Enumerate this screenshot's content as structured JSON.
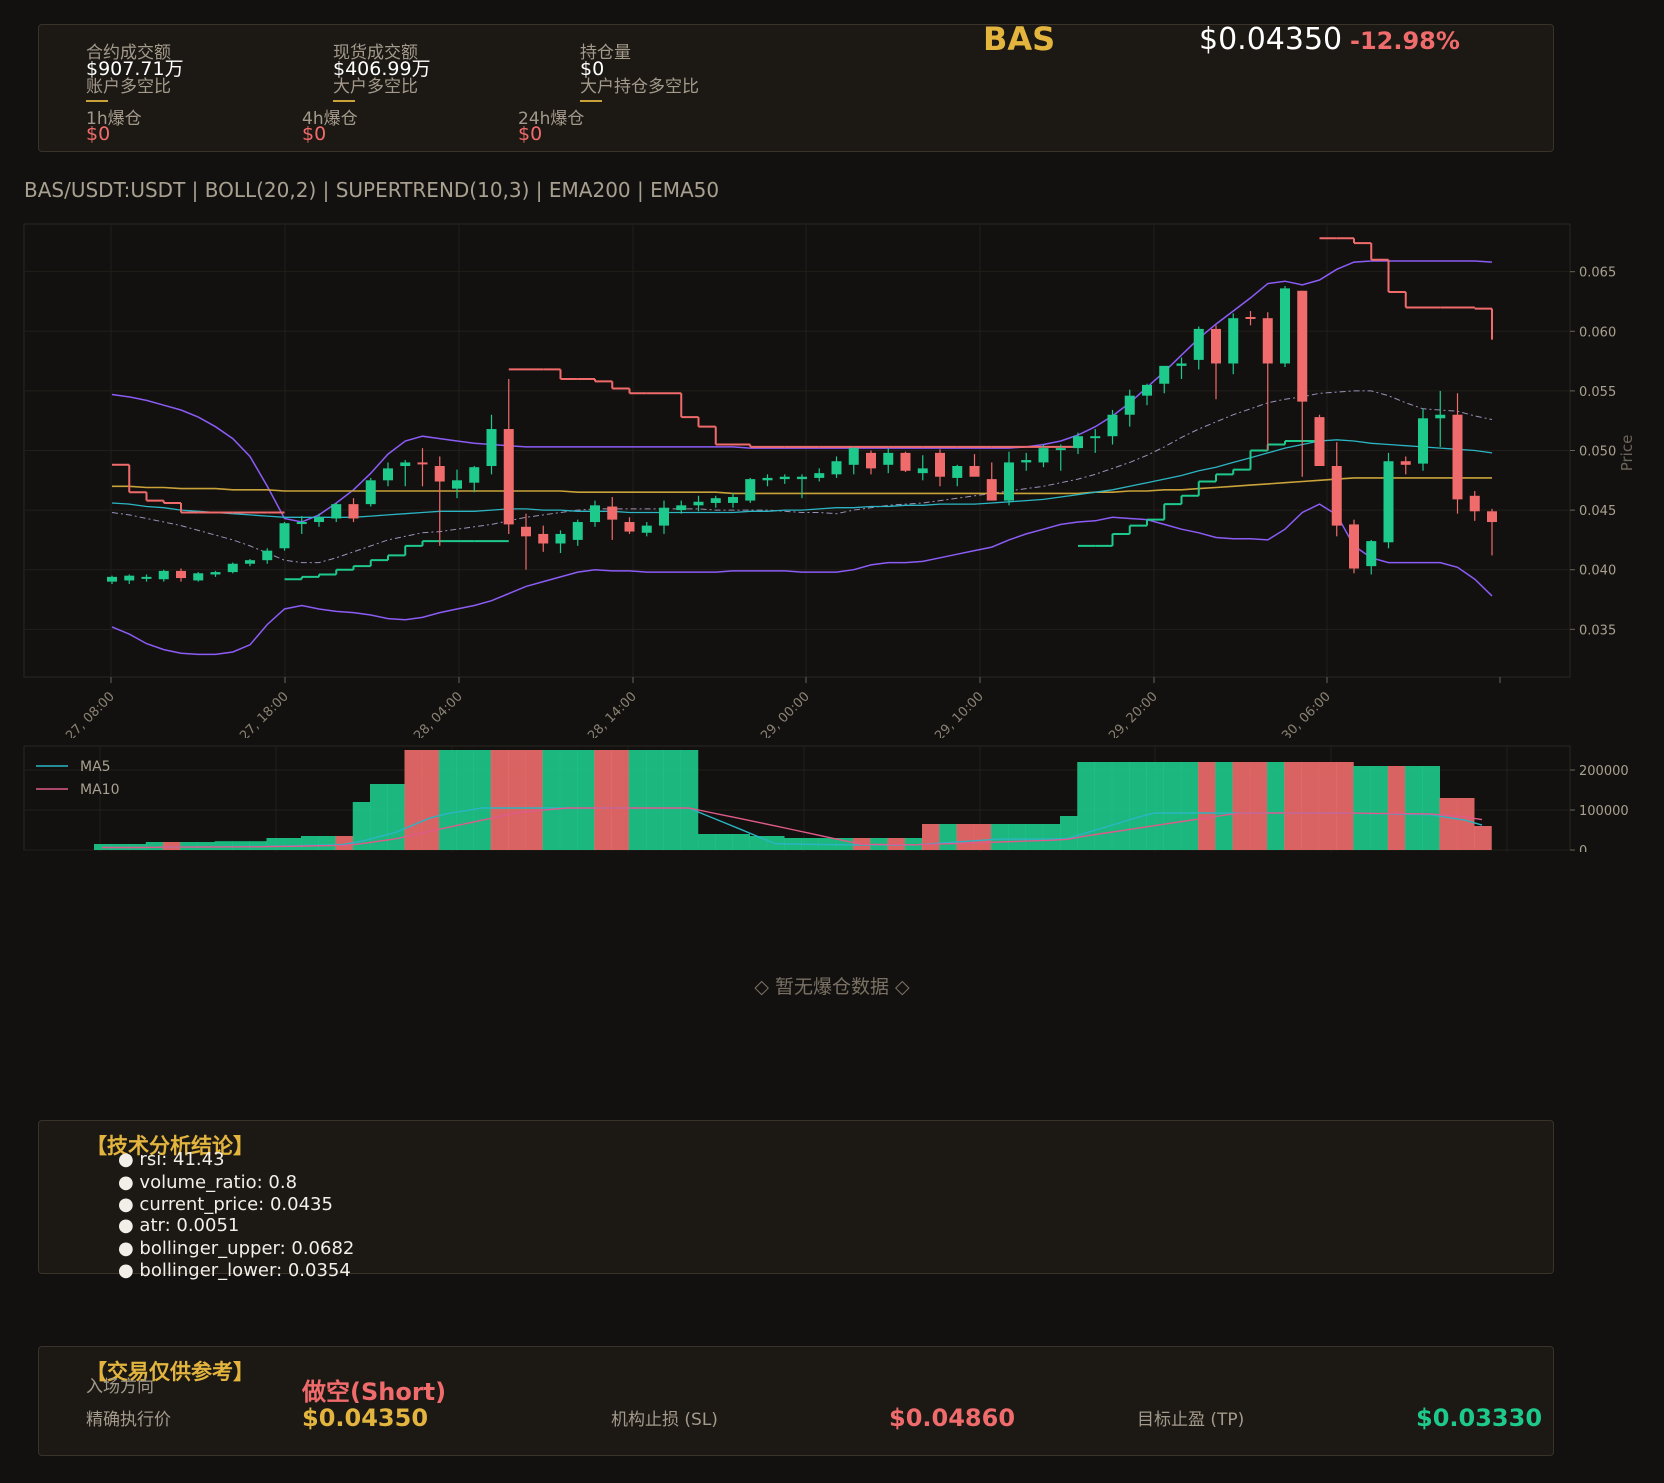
{
  "header": {
    "symbol": "BAS",
    "price": "$0.04350",
    "change": "-12.98%",
    "futures_volume_label": "合约成交额",
    "futures_volume": "$907.71万",
    "spot_volume_label": "现货成交额",
    "spot_volume": "$406.99万",
    "open_interest_label": "持仓量",
    "open_interest": "$0",
    "account_ls_label": "账户多空比",
    "top_trader_ls_label": "大户多空比",
    "top_position_ls_label": "大户持仓多空比",
    "liq_1h_label": "1h爆仓",
    "liq_1h": "$0",
    "liq_4h_label": "4h爆仓",
    "liq_4h": "$0",
    "liq_24h_label": "24h爆仓",
    "liq_24h": "$0"
  },
  "colors": {
    "up": "#1ec98c",
    "down": "#f06b6b",
    "boll": "#8b5cf6",
    "ema200": "#c9a33a",
    "ema50": "#2bb5c4",
    "gold": "#e3b53e",
    "ma5": "#2bb5c4",
    "ma10": "#e05a8a"
  },
  "chart_data": [
    {
      "type": "candlestick",
      "title": "BAS/USDT:USDT | BOLL(20,2) | SUPERTREND(10,3) | EMA200 | EMA50",
      "ylabel": "Price",
      "ylim": [
        0.031,
        0.069
      ],
      "y_ticks": [
        "0.035",
        "0.040",
        "0.045",
        "0.050",
        "0.055",
        "0.060",
        "0.065"
      ],
      "x_tick_labels": [
        "Jun 27, 08:00",
        "Jun 27, 18:00",
        "Jun 28, 04:00",
        "Jun 28, 14:00",
        "Jun 29, 00:00",
        "Jun 29, 10:00",
        "Jun 29, 20:00",
        "Jun 30, 06:00"
      ],
      "candles": [
        [
          0.039,
          0.0395,
          0.0388,
          0.0394
        ],
        [
          0.0391,
          0.0396,
          0.0388,
          0.0395
        ],
        [
          0.0393,
          0.0396,
          0.039,
          0.0394
        ],
        [
          0.0392,
          0.04,
          0.039,
          0.0399
        ],
        [
          0.0399,
          0.0401,
          0.039,
          0.0393
        ],
        [
          0.0391,
          0.0398,
          0.039,
          0.0397
        ],
        [
          0.0396,
          0.0399,
          0.0394,
          0.0398
        ],
        [
          0.0398,
          0.0406,
          0.0397,
          0.0405
        ],
        [
          0.0405,
          0.0409,
          0.0403,
          0.0408
        ],
        [
          0.0408,
          0.0418,
          0.0405,
          0.0416
        ],
        [
          0.0418,
          0.044,
          0.0416,
          0.0439
        ],
        [
          0.0439,
          0.0445,
          0.043,
          0.044
        ],
        [
          0.044,
          0.0447,
          0.0436,
          0.0444
        ],
        [
          0.0443,
          0.0456,
          0.044,
          0.0455
        ],
        [
          0.0455,
          0.046,
          0.044,
          0.0443
        ],
        [
          0.0455,
          0.0477,
          0.0453,
          0.0475
        ],
        [
          0.0475,
          0.049,
          0.047,
          0.0485
        ],
        [
          0.0487,
          0.0492,
          0.047,
          0.049
        ],
        [
          0.049,
          0.0502,
          0.047,
          0.0489
        ],
        [
          0.0487,
          0.0495,
          0.042,
          0.0474
        ],
        [
          0.0468,
          0.0484,
          0.046,
          0.0475
        ],
        [
          0.0473,
          0.0487,
          0.0465,
          0.0486
        ],
        [
          0.0487,
          0.053,
          0.048,
          0.0518
        ],
        [
          0.0518,
          0.056,
          0.043,
          0.0438
        ],
        [
          0.0436,
          0.0447,
          0.04,
          0.0428
        ],
        [
          0.043,
          0.0437,
          0.0415,
          0.0422
        ],
        [
          0.0422,
          0.0433,
          0.0414,
          0.043
        ],
        [
          0.0425,
          0.0442,
          0.042,
          0.044
        ],
        [
          0.044,
          0.0458,
          0.0436,
          0.0454
        ],
        [
          0.0453,
          0.0461,
          0.0425,
          0.0442
        ],
        [
          0.044,
          0.0444,
          0.043,
          0.0432
        ],
        [
          0.0431,
          0.044,
          0.0428,
          0.0437
        ],
        [
          0.0437,
          0.0458,
          0.043,
          0.0452
        ],
        [
          0.045,
          0.0458,
          0.0447,
          0.0454
        ],
        [
          0.0454,
          0.0462,
          0.0449,
          0.0457
        ],
        [
          0.0456,
          0.0462,
          0.0452,
          0.046
        ],
        [
          0.0456,
          0.0464,
          0.0452,
          0.0461
        ],
        [
          0.0458,
          0.0477,
          0.0456,
          0.0476
        ],
        [
          0.0475,
          0.048,
          0.047,
          0.0477
        ],
        [
          0.0476,
          0.048,
          0.0472,
          0.0478
        ],
        [
          0.0476,
          0.048,
          0.046,
          0.0478
        ],
        [
          0.0477,
          0.0485,
          0.0474,
          0.0481
        ],
        [
          0.048,
          0.0495,
          0.0477,
          0.0491
        ],
        [
          0.0488,
          0.0503,
          0.048,
          0.0502
        ],
        [
          0.0498,
          0.05,
          0.048,
          0.0485
        ],
        [
          0.0488,
          0.0502,
          0.0481,
          0.0498
        ],
        [
          0.0498,
          0.0499,
          0.0482,
          0.0483
        ],
        [
          0.0481,
          0.0496,
          0.0475,
          0.0485
        ],
        [
          0.0498,
          0.0501,
          0.047,
          0.0478
        ],
        [
          0.0477,
          0.0488,
          0.047,
          0.0487
        ],
        [
          0.0487,
          0.0497,
          0.0482,
          0.0478
        ],
        [
          0.0476,
          0.049,
          0.0468,
          0.0458
        ],
        [
          0.0458,
          0.0499,
          0.0454,
          0.049
        ],
        [
          0.049,
          0.0498,
          0.0483,
          0.0492
        ],
        [
          0.049,
          0.0505,
          0.0486,
          0.0502
        ],
        [
          0.0502,
          0.0505,
          0.0483,
          0.0502
        ],
        [
          0.0502,
          0.0515,
          0.0497,
          0.0512
        ],
        [
          0.0512,
          0.0518,
          0.0498,
          0.0512
        ],
        [
          0.0512,
          0.0534,
          0.0505,
          0.053
        ],
        [
          0.053,
          0.0551,
          0.052,
          0.0546
        ],
        [
          0.0546,
          0.0556,
          0.0538,
          0.0555
        ],
        [
          0.0556,
          0.057,
          0.0548,
          0.0571
        ],
        [
          0.0571,
          0.0578,
          0.056,
          0.0573
        ],
        [
          0.0576,
          0.0604,
          0.0568,
          0.0602
        ],
        [
          0.0602,
          0.0605,
          0.0543,
          0.0573
        ],
        [
          0.0573,
          0.0615,
          0.0564,
          0.0611
        ],
        [
          0.0612,
          0.0617,
          0.0605,
          0.0611
        ],
        [
          0.0611,
          0.0616,
          0.05,
          0.0573
        ],
        [
          0.0573,
          0.0638,
          0.057,
          0.0636
        ],
        [
          0.0634,
          0.0634,
          0.0478,
          0.0541
        ],
        [
          0.0528,
          0.053,
          0.049,
          0.0487
        ],
        [
          0.0487,
          0.0507,
          0.0428,
          0.0437
        ],
        [
          0.0438,
          0.0442,
          0.0397,
          0.0401
        ],
        [
          0.0403,
          0.0425,
          0.0396,
          0.0424
        ],
        [
          0.0423,
          0.0498,
          0.0418,
          0.0491
        ],
        [
          0.0491,
          0.0495,
          0.048,
          0.0488
        ],
        [
          0.0489,
          0.0535,
          0.0483,
          0.0527
        ],
        [
          0.0527,
          0.055,
          0.0503,
          0.053
        ],
        [
          0.053,
          0.0548,
          0.0447,
          0.0459
        ],
        [
          0.0462,
          0.0466,
          0.0441,
          0.0449
        ],
        [
          0.0449,
          0.0451,
          0.0412,
          0.044
        ]
      ],
      "boll_upper": [
        0.0547,
        0.0545,
        0.0542,
        0.0538,
        0.0534,
        0.0528,
        0.052,
        0.051,
        0.0495,
        0.047,
        0.0443,
        0.044,
        0.0446,
        0.0456,
        0.0467,
        0.0481,
        0.0497,
        0.0508,
        0.0512,
        0.051,
        0.0508,
        0.0506,
        0.0505,
        0.0504,
        0.0503,
        0.0503,
        0.0503,
        0.0503,
        0.0503,
        0.0503,
        0.0503,
        0.0503,
        0.0503,
        0.0503,
        0.0503,
        0.0503,
        0.0503,
        0.0502,
        0.0502,
        0.0502,
        0.0502,
        0.0502,
        0.0502,
        0.0502,
        0.0502,
        0.0502,
        0.0502,
        0.0502,
        0.0502,
        0.0502,
        0.0502,
        0.0502,
        0.0502,
        0.0503,
        0.0505,
        0.0508,
        0.0513,
        0.052,
        0.0529,
        0.054,
        0.0553,
        0.0566,
        0.058,
        0.0594,
        0.0606,
        0.0617,
        0.0628,
        0.064,
        0.0642,
        0.0639,
        0.0643,
        0.0652,
        0.0658,
        0.0659,
        0.0659,
        0.0659,
        0.0659,
        0.0659,
        0.0659,
        0.0659,
        0.0658
      ],
      "boll_lower": [
        0.0352,
        0.0346,
        0.0338,
        0.0333,
        0.033,
        0.0329,
        0.0329,
        0.0331,
        0.0337,
        0.0354,
        0.0367,
        0.037,
        0.0367,
        0.0365,
        0.0364,
        0.0362,
        0.0359,
        0.0358,
        0.036,
        0.0364,
        0.0367,
        0.037,
        0.0374,
        0.038,
        0.0386,
        0.039,
        0.0394,
        0.0398,
        0.04,
        0.0399,
        0.0399,
        0.0398,
        0.0398,
        0.0398,
        0.0398,
        0.0398,
        0.0399,
        0.0399,
        0.0399,
        0.0399,
        0.0398,
        0.0398,
        0.0398,
        0.04,
        0.0404,
        0.0406,
        0.0406,
        0.0407,
        0.041,
        0.0413,
        0.0416,
        0.0419,
        0.0425,
        0.043,
        0.0434,
        0.0438,
        0.044,
        0.0441,
        0.0444,
        0.0443,
        0.0442,
        0.0438,
        0.0434,
        0.0431,
        0.0427,
        0.0426,
        0.0426,
        0.0425,
        0.0434,
        0.0448,
        0.0455,
        0.0446,
        0.042,
        0.041,
        0.0406,
        0.0406,
        0.0406,
        0.0406,
        0.0402,
        0.0392,
        0.0378
      ],
      "boll_mid": [
        0.0448,
        0.0446,
        0.0443,
        0.044,
        0.0437,
        0.0433,
        0.0429,
        0.0425,
        0.042,
        0.0414,
        0.0408,
        0.0406,
        0.0406,
        0.041,
        0.0415,
        0.042,
        0.0425,
        0.0428,
        0.0431,
        0.0432,
        0.0434,
        0.0436,
        0.0438,
        0.0441,
        0.0444,
        0.0446,
        0.0448,
        0.045,
        0.0451,
        0.0451,
        0.0451,
        0.0451,
        0.0451,
        0.0451,
        0.0451,
        0.045,
        0.045,
        0.045,
        0.045,
        0.0449,
        0.0448,
        0.0448,
        0.0447,
        0.045,
        0.0452,
        0.0454,
        0.0455,
        0.0456,
        0.0458,
        0.046,
        0.0462,
        0.0464,
        0.0466,
        0.0468,
        0.047,
        0.0473,
        0.0476,
        0.048,
        0.0485,
        0.049,
        0.0496,
        0.0503,
        0.0511,
        0.0518,
        0.0524,
        0.053,
        0.0535,
        0.054,
        0.0543,
        0.0545,
        0.0548,
        0.0549,
        0.055,
        0.055,
        0.0546,
        0.054,
        0.0535,
        0.0534,
        0.0533,
        0.0529,
        0.0526
      ],
      "ema200": [
        0.047,
        0.047,
        0.0469,
        0.0469,
        0.0468,
        0.0468,
        0.0468,
        0.0467,
        0.0467,
        0.0467,
        0.0466,
        0.0466,
        0.0466,
        0.0466,
        0.0466,
        0.0466,
        0.0466,
        0.0466,
        0.0466,
        0.0466,
        0.0466,
        0.0466,
        0.0466,
        0.0466,
        0.0466,
        0.0466,
        0.0466,
        0.0465,
        0.0465,
        0.0465,
        0.0465,
        0.0465,
        0.0465,
        0.0465,
        0.0465,
        0.0465,
        0.0464,
        0.0464,
        0.0464,
        0.0464,
        0.0464,
        0.0464,
        0.0464,
        0.0464,
        0.0464,
        0.0464,
        0.0464,
        0.0464,
        0.0464,
        0.0464,
        0.0464,
        0.0464,
        0.0464,
        0.0464,
        0.0464,
        0.0464,
        0.0464,
        0.0465,
        0.0465,
        0.0466,
        0.0466,
        0.0467,
        0.0467,
        0.0468,
        0.0469,
        0.047,
        0.0471,
        0.0472,
        0.0473,
        0.0474,
        0.0475,
        0.0476,
        0.0477,
        0.0477,
        0.0477,
        0.0477,
        0.0477,
        0.0477,
        0.0477,
        0.0477,
        0.0477
      ],
      "ema50": [
        0.0456,
        0.0455,
        0.0453,
        0.0452,
        0.045,
        0.0449,
        0.0448,
        0.0447,
        0.0446,
        0.0445,
        0.0444,
        0.0444,
        0.0444,
        0.0444,
        0.0444,
        0.0445,
        0.0446,
        0.0447,
        0.0448,
        0.0449,
        0.0449,
        0.0449,
        0.045,
        0.0451,
        0.0451,
        0.045,
        0.045,
        0.0449,
        0.0449,
        0.0449,
        0.0448,
        0.0448,
        0.0448,
        0.0448,
        0.0448,
        0.0448,
        0.0448,
        0.0449,
        0.0449,
        0.045,
        0.045,
        0.0451,
        0.0452,
        0.0452,
        0.0453,
        0.0453,
        0.0454,
        0.0454,
        0.0455,
        0.0455,
        0.0455,
        0.0456,
        0.0457,
        0.0458,
        0.0459,
        0.0461,
        0.0463,
        0.0465,
        0.0467,
        0.047,
        0.0473,
        0.0476,
        0.0479,
        0.0483,
        0.0486,
        0.049,
        0.0494,
        0.0498,
        0.0502,
        0.0505,
        0.0508,
        0.0509,
        0.0508,
        0.0506,
        0.0505,
        0.0504,
        0.0503,
        0.0502,
        0.0501,
        0.05,
        0.0498
      ],
      "supertrend": [
        0.0488,
        0.0465,
        0.0458,
        0.0456,
        0.0448,
        0.0448,
        0.0448,
        0.0448,
        0.0448,
        0.0448,
        0.0392,
        0.0394,
        0.0396,
        0.04,
        0.0403,
        0.0408,
        0.0412,
        0.042,
        0.0424,
        0.0424,
        0.0424,
        0.0424,
        0.0424,
        0.0568,
        0.0568,
        0.0568,
        0.056,
        0.056,
        0.0558,
        0.0552,
        0.0548,
        0.0548,
        0.0548,
        0.0528,
        0.052,
        0.0505,
        0.0505,
        0.0503,
        0.0503,
        0.0503,
        0.0503,
        0.0503,
        0.0503,
        0.0503,
        0.0503,
        0.0503,
        0.0503,
        0.0503,
        0.0503,
        0.0503,
        0.0503,
        0.0503,
        0.0503,
        0.0503,
        0.0503,
        0.0503,
        0.042,
        0.042,
        0.043,
        0.0437,
        0.0442,
        0.0455,
        0.0462,
        0.0474,
        0.048,
        0.0484,
        0.05,
        0.0505,
        0.0508,
        0.0508,
        0.0678,
        0.0678,
        0.0674,
        0.066,
        0.0633,
        0.062,
        0.062,
        0.062,
        0.062,
        0.0619,
        0.0593
      ]
    },
    {
      "type": "bar",
      "series": [
        {
          "name": "MA5"
        },
        {
          "name": "MA10"
        }
      ],
      "ylim": [
        0,
        260000
      ],
      "y_ticks": [
        "0",
        "100000",
        "200000"
      ],
      "values": [
        15000,
        15000,
        15000,
        20000,
        20000,
        20000,
        20000,
        22000,
        22000,
        22000,
        30000,
        30000,
        35000,
        35000,
        35000,
        120000,
        165000,
        165000,
        250000,
        250000,
        250000,
        250000,
        250000,
        250000,
        250000,
        250000,
        250000,
        250000,
        250000,
        250000,
        250000,
        250000,
        250000,
        250000,
        250000,
        40000,
        40000,
        40000,
        35000,
        35000,
        30000,
        30000,
        30000,
        30000,
        30000,
        30000,
        30000,
        30000,
        65000,
        65000,
        65000,
        65000,
        65000,
        65000,
        65000,
        65000,
        85000,
        220000,
        220000,
        220000,
        220000,
        220000,
        220000,
        220000,
        220000,
        220000,
        220000,
        220000,
        220000,
        220000,
        220000,
        220000,
        220000,
        210000,
        210000,
        210000,
        210000,
        210000,
        130000,
        130000,
        60000
      ]
    }
  ],
  "liquidation": {
    "empty_message": "◇ 暂无爆仓数据 ◇"
  },
  "analysis": {
    "title": "【技术分析结论】",
    "items": [
      "● rsi: 41.43",
      "● volume_ratio: 0.8",
      "● current_price: 0.0435",
      "● atr: 0.0051",
      "● bollinger_upper: 0.0682",
      "● bollinger_lower: 0.0354"
    ]
  },
  "trade": {
    "title": "【交易仅供参考】",
    "direction_label": "入场方向",
    "direction_value": "做空(Short)",
    "entry_label": "精确执行价",
    "entry_value": "$0.04350",
    "sl_label": "机构止损 (SL)",
    "sl_value": "$0.04860",
    "tp_label": "目标止盈 (TP)",
    "tp_value": "$0.03330"
  }
}
